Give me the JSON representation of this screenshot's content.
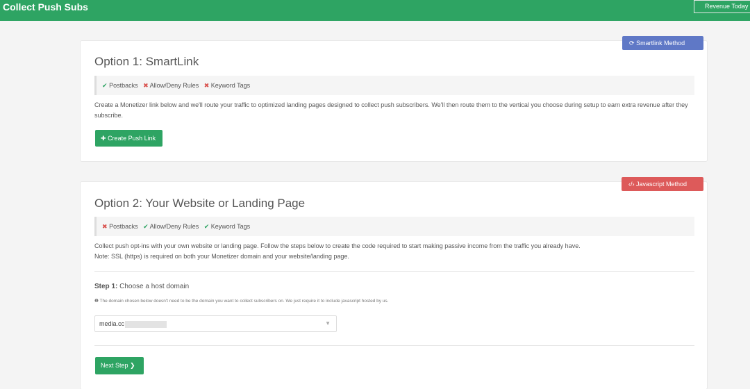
{
  "header": {
    "title": "Collect Push Subs",
    "revenue_button": "Revenue Today"
  },
  "option1": {
    "badge_icon": "refresh-icon",
    "badge": "Smartlink Method",
    "title": "Option 1: SmartLink",
    "features": [
      {
        "status": "check",
        "label": "Postbacks"
      },
      {
        "status": "cross",
        "label": "Allow/Deny Rules"
      },
      {
        "status": "cross",
        "label": "Keyword Tags"
      }
    ],
    "description": "Create a Monetizer link below and we'll route your traffic to optimized landing pages designed to collect push subscribers. We'll then route them to the vertical you choose during setup to earn extra revenue after they subscribe.",
    "button": "Create Push Link"
  },
  "option2": {
    "badge_icon": "code-icon",
    "badge": "Javascript Method",
    "title": "Option 2: Your Website or Landing Page",
    "features": [
      {
        "status": "cross",
        "label": "Postbacks"
      },
      {
        "status": "check",
        "label": "Allow/Deny Rules"
      },
      {
        "status": "check",
        "label": "Keyword Tags"
      }
    ],
    "description_line1": "Collect push opt-ins with your own website or landing page. Follow the steps below to create the code required to start making passive income from the traffic you already have.",
    "description_line2": "Note: SSL (https) is required on both your Monetizer domain and your website/landing page.",
    "step_prefix": "Step 1:",
    "step_label": "Choose a host domain",
    "step_note": "The domain chosen below doesn't need to be the domain you want to collect subscribers on. We just require it to include javascript hosted by us.",
    "domain_value": "media.cc",
    "next_button": "Next Step"
  },
  "colors": {
    "header": "#2ea463",
    "smartlink": "#5f78c6",
    "javascript": "#dd5a5a",
    "success": "#2ea463",
    "danger": "#d9534f"
  }
}
